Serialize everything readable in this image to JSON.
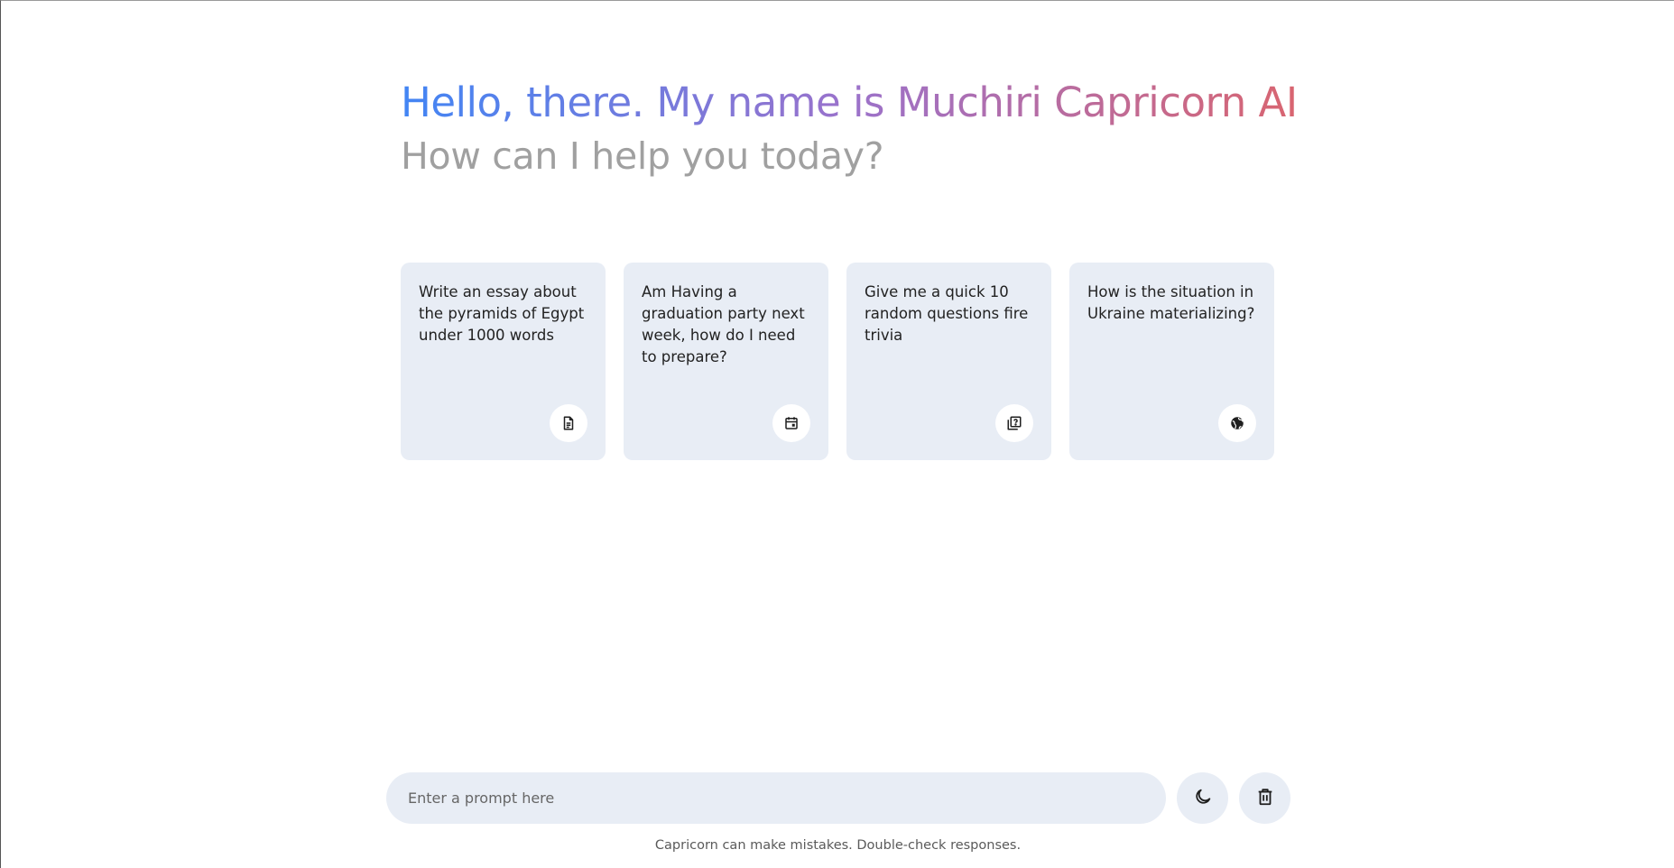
{
  "header": {
    "title": "Hello, there. My name is Muchiri Capricorn AI",
    "subtitle": "How can I help you today?"
  },
  "suggestions": [
    {
      "text": "Write an essay about the pyramids of Egypt under 1000 words",
      "icon": "document-icon"
    },
    {
      "text": "Am Having a graduation party next week, how do I need to prepare?",
      "icon": "calendar-icon"
    },
    {
      "text": "Give me a quick 10 random questions fire trivia",
      "icon": "quiz-icon"
    },
    {
      "text": "How is the situation in Ukraine materializing?",
      "icon": "globe-icon"
    }
  ],
  "prompt": {
    "placeholder": "Enter a prompt here",
    "value": ""
  },
  "actions": {
    "theme_icon": "moon-icon",
    "delete_icon": "trash-icon"
  },
  "disclaimer": "Capricorn can make mistakes. Double-check responses."
}
